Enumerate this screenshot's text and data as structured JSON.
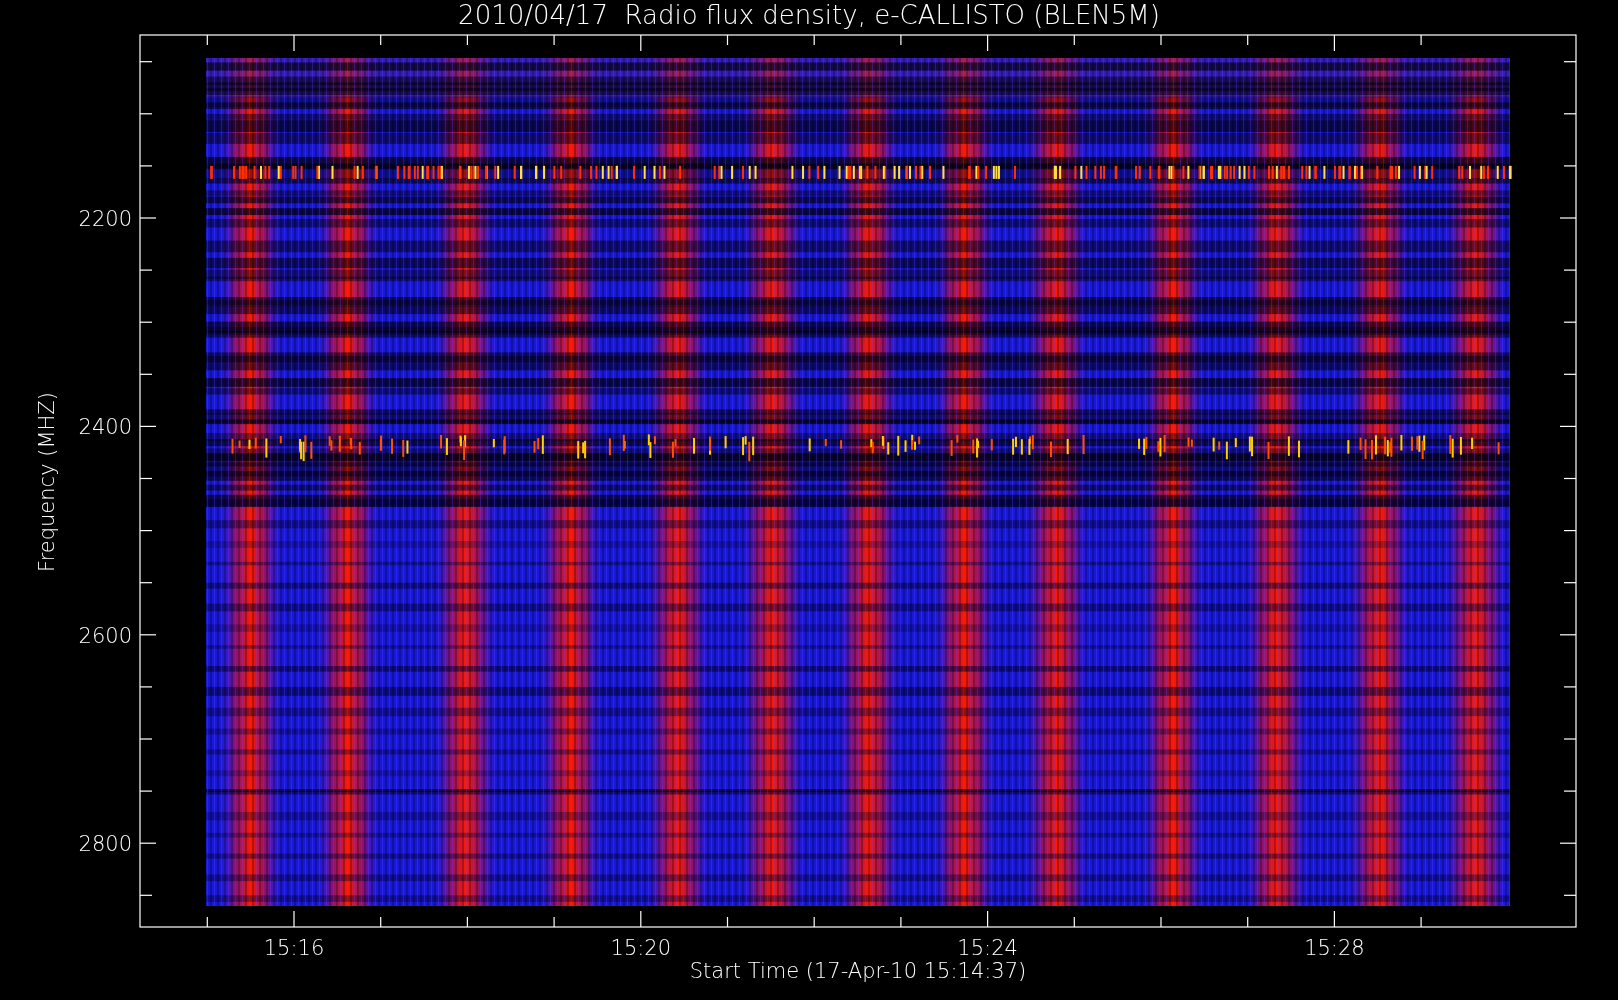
{
  "plot": {
    "title": "2010/04/17  Radio flux density, e-CALLISTO (BLEN5M)",
    "xlabel": "Start Time (17-Apr-10 15:14:37)",
    "ylabel": "Frequency (MHZ)",
    "x_tick_labels": [
      "15:16",
      "15:20",
      "15:24",
      "15:28"
    ],
    "y_tick_labels": [
      "2200",
      "2400",
      "2600",
      "2800"
    ]
  }
}
